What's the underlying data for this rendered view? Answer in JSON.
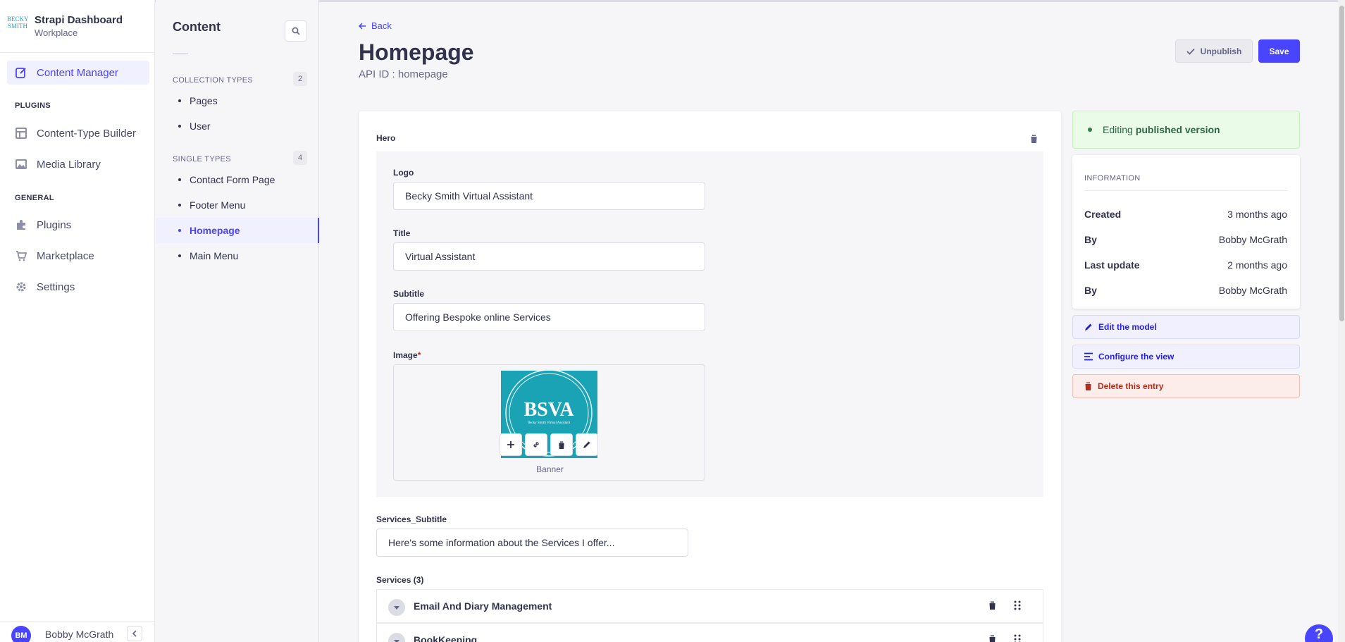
{
  "brand": {
    "logo_text": "BECKY SMITH",
    "title": "Strapi Dashboard",
    "subtitle": "Workplace"
  },
  "mainnav": {
    "content_manager": "Content Manager",
    "plugins_section": "PLUGINS",
    "content_type_builder": "Content-Type Builder",
    "media_library": "Media Library",
    "general_section": "GENERAL",
    "plugins": "Plugins",
    "marketplace": "Marketplace",
    "settings": "Settings"
  },
  "user": {
    "initials": "BM",
    "name": "Bobby McGrath"
  },
  "subnav": {
    "title": "Content",
    "collection_types_label": "COLLECTION TYPES",
    "collection_types_count": "2",
    "collection_types": [
      "Pages",
      "User"
    ],
    "single_types_label": "SINGLE TYPES",
    "single_types_count": "4",
    "single_types": [
      "Contact Form Page",
      "Footer Menu",
      "Homepage",
      "Main Menu"
    ]
  },
  "header": {
    "back": "Back",
    "title": "Homepage",
    "api_id": "API ID : homepage",
    "unpublish": "Unpublish",
    "save": "Save"
  },
  "form": {
    "hero_label": "Hero",
    "logo_label": "Logo",
    "logo_value": "Becky Smith Virtual Assistant",
    "title_label": "Title",
    "title_value": "Virtual Assistant",
    "subtitle_label": "Subtitle",
    "subtitle_value": "Offering Bespoke online Services",
    "image_label": "Image",
    "image_required": "*",
    "image_thumb_text": "BSVA",
    "image_thumb_small": "Becky Smith Virtual Assistant",
    "image_caption": "Banner",
    "services_subtitle_label": "Services_Subtitle",
    "services_subtitle_value": "Here's some information about the Services I offer...",
    "services_label": "Services (3)",
    "services": [
      "Email And Diary Management",
      "BookKeeping"
    ]
  },
  "sidebar": {
    "status_prefix": "Editing",
    "status_strong": "published version",
    "info_title": "INFORMATION",
    "rows": [
      {
        "key": "Created",
        "value": "3 months ago"
      },
      {
        "key": "By",
        "value": "Bobby McGrath"
      },
      {
        "key": "Last update",
        "value": "2 months ago"
      },
      {
        "key": "By",
        "value": "Bobby McGrath"
      }
    ],
    "edit_model": "Edit the model",
    "configure_view": "Configure the view",
    "delete_entry": "Delete this entry"
  },
  "help": "?"
}
